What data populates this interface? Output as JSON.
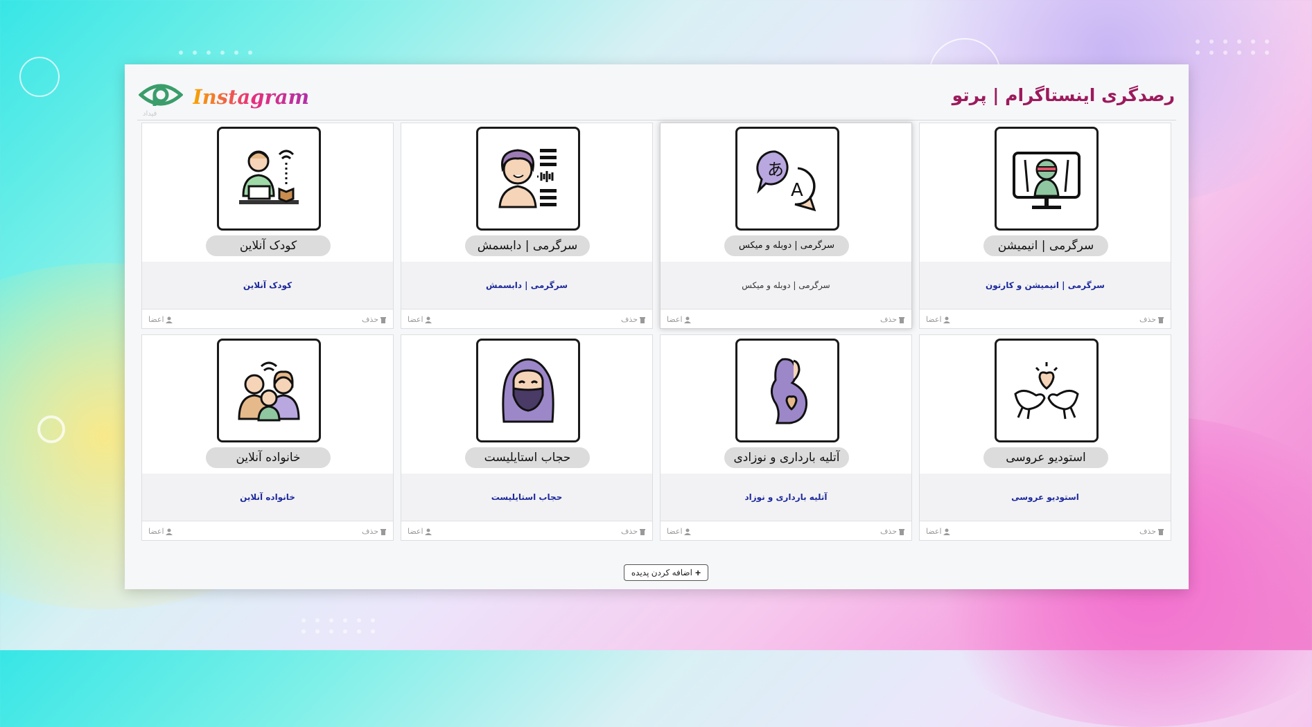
{
  "header": {
    "title": "رصدگری اینستاگرام | پرتو",
    "brand": "Instagram",
    "logo_sub": "فیداد"
  },
  "colors": {
    "title": "#9c1a5c",
    "link": "#1d2a9b",
    "logo_green": "#3a9d6a"
  },
  "cards": [
    {
      "pill": "سرگرمی | انیمیشن",
      "desc": "سرگرمی | انیمیشن و کارتون",
      "delete": "حذف",
      "members": "اعضا",
      "icon": "tv-ninja-icon"
    },
    {
      "pill": "سرگرمی | دوبله و میکس",
      "desc": "سرگرمی | دوبله و میکس",
      "delete": "حذف",
      "members": "اعضا",
      "icon": "translate-icon"
    },
    {
      "pill": "سرگرمی | دابسمش",
      "desc": "سرگرمی | دابسمش",
      "delete": "حذف",
      "members": "اعضا",
      "icon": "singer-icon"
    },
    {
      "pill": "کودک آنلاین",
      "desc": "کودک آنلاین",
      "delete": "حذف",
      "members": "اعضا",
      "icon": "child-online-icon"
    },
    {
      "pill": "استودیو عروسی",
      "desc": "استودیو عروسی",
      "delete": "حذف",
      "members": "اعضا",
      "icon": "wedding-doves-icon"
    },
    {
      "pill": "آتلیه بارداری و نوزادی",
      "desc": "آتلیه بارداری و نوزاد",
      "delete": "حذف",
      "members": "اعضا",
      "icon": "pregnancy-icon"
    },
    {
      "pill": "حجاب استایلیست",
      "desc": "حجاب استایلیست",
      "delete": "حذف",
      "members": "اعضا",
      "icon": "hijab-woman-icon"
    },
    {
      "pill": "خانواده آنلاین",
      "desc": "خانواده آنلاین",
      "delete": "حذف",
      "members": "اعضا",
      "icon": "family-online-icon"
    }
  ],
  "actions": {
    "add_label": "اضافه کردن پدیده"
  }
}
